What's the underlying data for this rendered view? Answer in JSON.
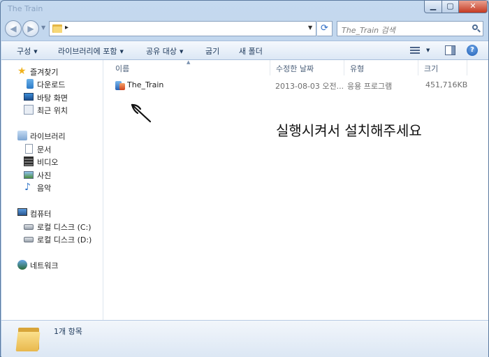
{
  "window": {
    "title": "The Train"
  },
  "navigation": {
    "back_icon": "back-arrow-icon",
    "forward_icon": "forward-arrow-icon",
    "address_separator": "▸",
    "refresh_glyph": "⟳",
    "search_placeholder": "The_Train 검색"
  },
  "toolbar": {
    "organize": "구성",
    "include_in_library": "라이브러리에 포함",
    "share_with": "공유 대상",
    "burn": "굽기",
    "new_folder": "새 폴더",
    "help": "?"
  },
  "sidebar": {
    "favorites": {
      "label": "즐겨찾기",
      "items": [
        {
          "label": "다운로드",
          "icon": "download-icon"
        },
        {
          "label": "바탕 화면",
          "icon": "desktop-icon"
        },
        {
          "label": "최근 위치",
          "icon": "recent-places-icon"
        }
      ]
    },
    "libraries": {
      "label": "라이브러리",
      "items": [
        {
          "label": "문서",
          "icon": "documents-icon"
        },
        {
          "label": "비디오",
          "icon": "video-icon"
        },
        {
          "label": "사진",
          "icon": "pictures-icon"
        },
        {
          "label": "음악",
          "icon": "music-icon"
        }
      ]
    },
    "computer": {
      "label": "컴퓨터",
      "items": [
        {
          "label": "로컬 디스크 (C:)",
          "icon": "local-disk-icon"
        },
        {
          "label": "로컬 디스크 (D:)",
          "icon": "local-disk-icon"
        }
      ]
    },
    "network": {
      "label": "네트워크",
      "icon": "network-icon"
    }
  },
  "file_list": {
    "columns": [
      "이름",
      "수정한 날짜",
      "유형",
      "크기"
    ],
    "rows": [
      {
        "name": "The_Train",
        "modified": "2013-08-03 오전...",
        "type": "응용 프로그램",
        "size": "451,716KB"
      }
    ]
  },
  "annotation": {
    "text": "실행시켜서 설치해주세요"
  },
  "details": {
    "item_count": "1개 항목"
  },
  "colors": {
    "accent": "#1e395b",
    "window_frame": "#a9c4e3",
    "close_button": "#c53a22"
  }
}
